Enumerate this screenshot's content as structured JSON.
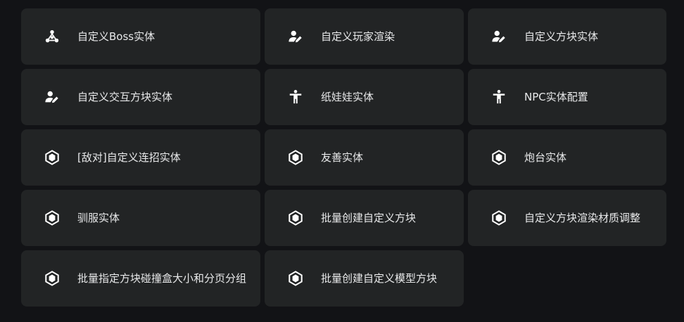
{
  "grid": {
    "items": [
      {
        "label": "自定义Boss实体",
        "icon": "boss-icon"
      },
      {
        "label": "自定义玩家渲染",
        "icon": "user-edit-icon"
      },
      {
        "label": "自定义方块实体",
        "icon": "user-edit-icon"
      },
      {
        "label": "自定义交互方块实体",
        "icon": "user-edit-icon"
      },
      {
        "label": "纸娃娃实体",
        "icon": "person-icon"
      },
      {
        "label": "NPC实体配置",
        "icon": "person-icon"
      },
      {
        "label": "[敌对]自定义连招实体",
        "icon": "hexagon-icon"
      },
      {
        "label": "友善实体",
        "icon": "hexagon-icon"
      },
      {
        "label": "炮台实体",
        "icon": "hexagon-icon"
      },
      {
        "label": "驯服实体",
        "icon": "hexagon-icon"
      },
      {
        "label": "批量创建自定义方块",
        "icon": "hexagon-icon"
      },
      {
        "label": "自定义方块渲染材质调整",
        "icon": "hexagon-icon"
      },
      {
        "label": "批量指定方块碰撞盒大小和分页分组",
        "icon": "hexagon-icon"
      },
      {
        "label": "批量创建自定义模型方块",
        "icon": "hexagon-icon"
      }
    ]
  },
  "colors": {
    "background": "#121316",
    "card": "#222425",
    "text": "#e8e9ea",
    "icon": "#ffffff"
  }
}
